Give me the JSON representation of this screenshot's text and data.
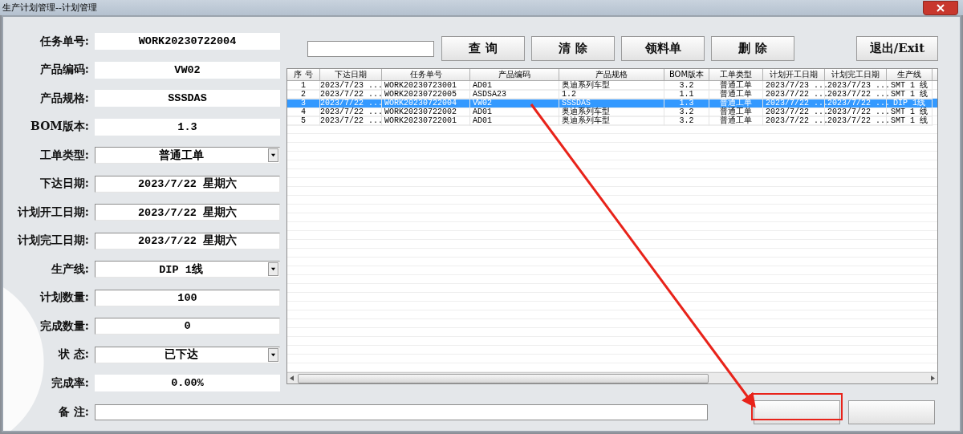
{
  "window": {
    "title": "生产计划管理--计划管理"
  },
  "form": {
    "fields": [
      {
        "label": "任务单号:",
        "kind": "text",
        "value": "WORK20230722004"
      },
      {
        "label": "产品编码:",
        "kind": "text",
        "value": "VW02"
      },
      {
        "label": "产品规格:",
        "kind": "text",
        "value": "SSSDAS"
      },
      {
        "label": "BOM版本:",
        "kind": "text",
        "value": "1.3"
      },
      {
        "label": "工单类型:",
        "kind": "select",
        "value": "普通工单"
      },
      {
        "label": "下达日期:",
        "kind": "input",
        "value": "2023/7/22 星期六"
      },
      {
        "label": "计划开工日期:",
        "kind": "input",
        "value": "2023/7/22 星期六"
      },
      {
        "label": "计划完工日期:",
        "kind": "input",
        "value": "2023/7/22 星期六"
      },
      {
        "label": "生产线:",
        "kind": "select",
        "value": "DIP 1线"
      },
      {
        "label": "计划数量:",
        "kind": "input",
        "value": "100"
      },
      {
        "label": "完成数量:",
        "kind": "input",
        "value": "0"
      },
      {
        "label": "状 态:",
        "kind": "select",
        "value": "已下达"
      },
      {
        "label": "完成率:",
        "kind": "text",
        "value": "0.00%"
      }
    ],
    "remarks": {
      "label": "备 注:"
    }
  },
  "toolbar": {
    "buttons": [
      "查 询",
      "清 除",
      "领料单",
      "删 除"
    ],
    "exit": "退出/Exit"
  },
  "table": {
    "columns": [
      "序 号",
      "下达日期",
      "任务单号",
      "产品编码",
      "产品规格",
      "BOM版本",
      "工单类型",
      "计划开工日期",
      "计划完工日期",
      "生产线"
    ],
    "rows": [
      {
        "selected": false,
        "cells": [
          "1",
          "2023/7/23 ...",
          "WORK20230723001",
          "AD01",
          "奥迪系列车型",
          "3.2",
          "普通工单",
          "2023/7/23 ...",
          "2023/7/23 ...",
          "SMT 1 线"
        ]
      },
      {
        "selected": false,
        "cells": [
          "2",
          "2023/7/22 ...",
          "WORK20230722005",
          "ASDSA23",
          "1.2",
          "1.1",
          "普通工单",
          "2023/7/22 ...",
          "2023/7/22 ...",
          "SMT 1 线"
        ]
      },
      {
        "selected": true,
        "cells": [
          "3",
          "2023/7/22 ...",
          "WORK20230722004",
          "VW02",
          "SSSDAS",
          "1.3",
          "普通工单",
          "2023/7/22 ...",
          "2023/7/22 ...",
          "DIP 1线"
        ]
      },
      {
        "selected": false,
        "cells": [
          "4",
          "2023/7/22 ...",
          "WORK20230722002",
          "AD01",
          "奥迪系列车型",
          "3.2",
          "普通工单",
          "2023/7/22 ...",
          "2023/7/22 ...",
          "SMT 1 线"
        ]
      },
      {
        "selected": false,
        "cells": [
          "5",
          "2023/7/22 ...",
          "WORK20230722001",
          "AD01",
          "奥迪系列车型",
          "3.2",
          "普通工单",
          "2023/7/22 ...",
          "2023/7/22 ...",
          "SMT 1 线"
        ]
      }
    ]
  }
}
